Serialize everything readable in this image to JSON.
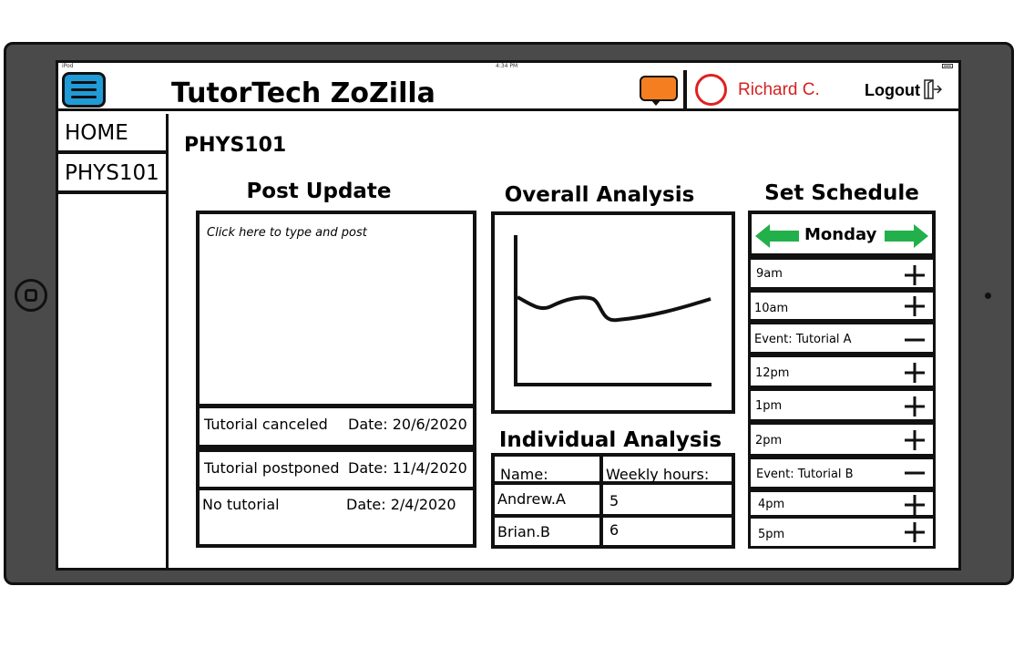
{
  "statusbar": {
    "device": "iPod",
    "time": "4:34 PM"
  },
  "header": {
    "app_title": "TutorTech ZoZilla",
    "user_name": "Richard C.",
    "logout_label": "Logout",
    "chat_color": "#f57f20",
    "menu_color": "#1f9bd8",
    "accent_red": "#d62020"
  },
  "sidebar": {
    "items": [
      {
        "label": "HOME",
        "icon": ""
      },
      {
        "label": "PHYS101",
        "icon": ""
      }
    ]
  },
  "page": {
    "title": "PHYS101"
  },
  "post_update": {
    "title": "Post Update",
    "placeholder": "Click here to type and post",
    "updates": [
      {
        "text": "Tutorial canceled",
        "date": "Date: 20/6/2020"
      },
      {
        "text": "Tutorial postponed",
        "date": "Date: 11/4/2020"
      },
      {
        "text": "No tutorial",
        "date": "Date: 2/4/2020"
      }
    ]
  },
  "overall_analysis": {
    "title": "Overall Analysis"
  },
  "individual_analysis": {
    "title": "Individual Analysis",
    "headers": [
      "Name:",
      "Weekly hours:"
    ],
    "rows": [
      [
        "Andrew.A",
        "5"
      ],
      [
        "Brian.B",
        "6"
      ]
    ]
  },
  "schedule": {
    "title": "Set Schedule",
    "day": "Monday",
    "arrow_color": "#22b04a",
    "slots": [
      {
        "label": "9am",
        "action": "plus"
      },
      {
        "label": "10am",
        "action": "plus"
      },
      {
        "label": "Event: Tutorial A",
        "action": "minus"
      },
      {
        "label": "12pm",
        "action": "plus"
      },
      {
        "label": "1pm",
        "action": "plus"
      },
      {
        "label": "2pm",
        "action": "plus"
      },
      {
        "label": "Event: Tutorial B",
        "action": "minus"
      },
      {
        "label": "4pm",
        "action": "plus"
      },
      {
        "label": "5pm",
        "action": "plus"
      }
    ]
  }
}
